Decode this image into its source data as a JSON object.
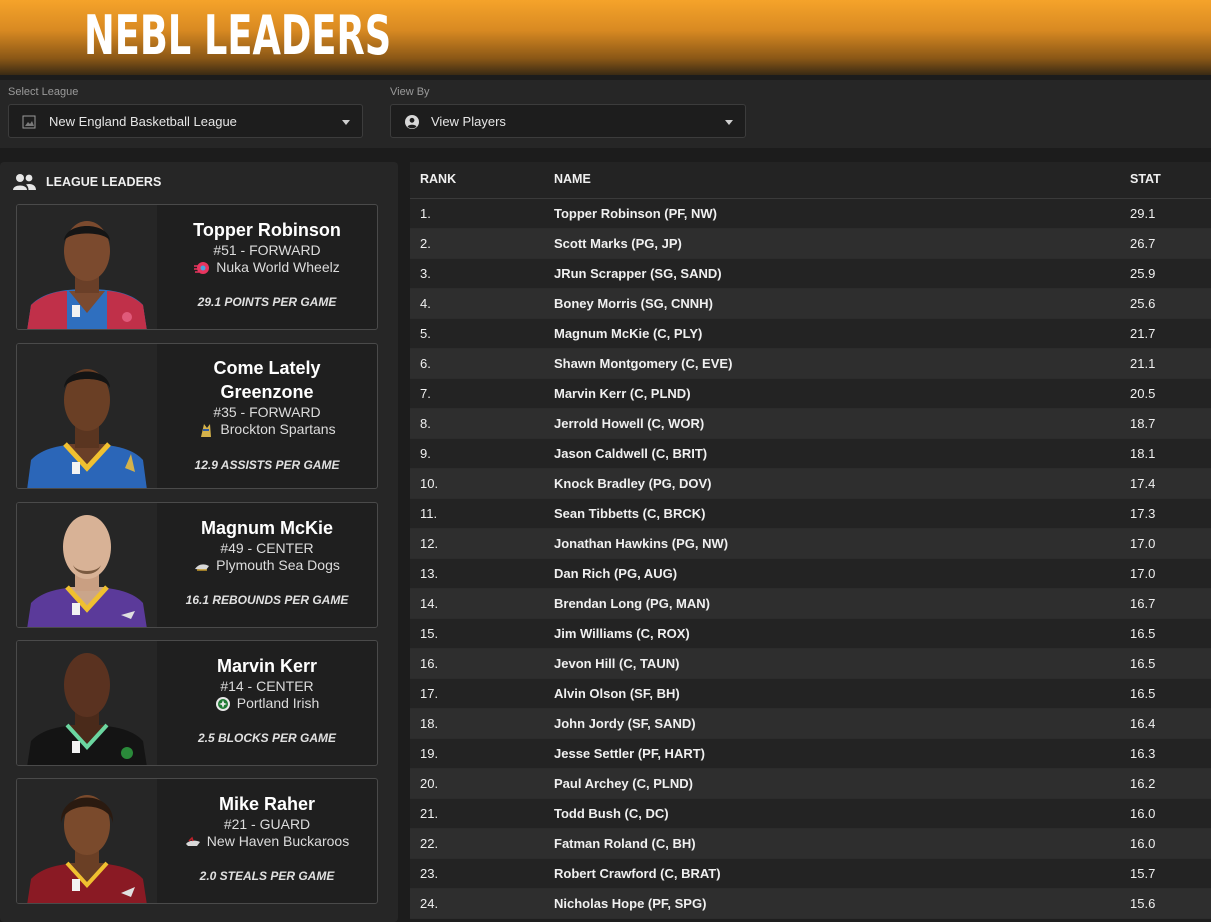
{
  "header": {
    "title": "NEBL LEADERS"
  },
  "filters": {
    "league_label": "Select League",
    "league_value": "New England Basketball League",
    "view_label": "View By",
    "view_value": "View Players"
  },
  "leaders_panel": {
    "title": "LEAGUE LEADERS",
    "cards": [
      {
        "name": "Topper Robinson",
        "number_position": "#51 - FORWARD",
        "team": "Nuka World Wheelz",
        "stat": "29.1 POINTS PER GAME"
      },
      {
        "name": "Come Lately Greenzone",
        "number_position": "#35 - FORWARD",
        "team": "Brockton Spartans",
        "stat": "12.9 ASSISTS PER GAME"
      },
      {
        "name": "Magnum McKie",
        "number_position": "#49 - CENTER",
        "team": "Plymouth Sea Dogs",
        "stat": "16.1 REBOUNDS PER GAME"
      },
      {
        "name": "Marvin Kerr",
        "number_position": "#14 - CENTER",
        "team": "Portland Irish",
        "stat": "2.5 BLOCKS PER GAME"
      },
      {
        "name": "Mike Raher",
        "number_position": "#21 - GUARD",
        "team": "New Haven Buckaroos",
        "stat": "2.0 STEALS PER GAME"
      }
    ]
  },
  "table": {
    "columns": {
      "rank": "RANK",
      "name": "NAME",
      "stat": "STAT"
    },
    "rows": [
      {
        "rank": "1.",
        "name": "Topper Robinson (PF, NW)",
        "stat": "29.1"
      },
      {
        "rank": "2.",
        "name": "Scott Marks (PG, JP)",
        "stat": "26.7"
      },
      {
        "rank": "3.",
        "name": "JRun Scrapper (SG, SAND)",
        "stat": "25.9"
      },
      {
        "rank": "4.",
        "name": "Boney Morris (SG, CNNH)",
        "stat": "25.6"
      },
      {
        "rank": "5.",
        "name": "Magnum McKie (C, PLY)",
        "stat": "21.7"
      },
      {
        "rank": "6.",
        "name": "Shawn Montgomery (C, EVE)",
        "stat": "21.1"
      },
      {
        "rank": "7.",
        "name": "Marvin Kerr (C, PLND)",
        "stat": "20.5"
      },
      {
        "rank": "8.",
        "name": "Jerrold Howell (C, WOR)",
        "stat": "18.7"
      },
      {
        "rank": "9.",
        "name": "Jason Caldwell (C, BRIT)",
        "stat": "18.1"
      },
      {
        "rank": "10.",
        "name": "Knock Bradley (PG, DOV)",
        "stat": "17.4"
      },
      {
        "rank": "11.",
        "name": "Sean Tibbetts (C, BRCK)",
        "stat": "17.3"
      },
      {
        "rank": "12.",
        "name": "Jonathan Hawkins (PG, NW)",
        "stat": "17.0"
      },
      {
        "rank": "13.",
        "name": "Dan Rich (PG, AUG)",
        "stat": "17.0"
      },
      {
        "rank": "14.",
        "name": "Brendan Long (PG, MAN)",
        "stat": "16.7"
      },
      {
        "rank": "15.",
        "name": "Jim Williams (C, ROX)",
        "stat": "16.5"
      },
      {
        "rank": "16.",
        "name": "Jevon Hill (C, TAUN)",
        "stat": "16.5"
      },
      {
        "rank": "17.",
        "name": "Alvin Olson (SF, BH)",
        "stat": "16.5"
      },
      {
        "rank": "18.",
        "name": "John Jordy (SF, SAND)",
        "stat": "16.4"
      },
      {
        "rank": "19.",
        "name": "Jesse Settler (PF, HART)",
        "stat": "16.3"
      },
      {
        "rank": "20.",
        "name": "Paul Archey (C, PLND)",
        "stat": "16.2"
      },
      {
        "rank": "21.",
        "name": "Todd Bush (C, DC)",
        "stat": "16.0"
      },
      {
        "rank": "22.",
        "name": "Fatman Roland (C, BH)",
        "stat": "16.0"
      },
      {
        "rank": "23.",
        "name": "Robert Crawford (C, BRAT)",
        "stat": "15.7"
      },
      {
        "rank": "24.",
        "name": "Nicholas Hope (PF, SPG)",
        "stat": "15.6"
      }
    ]
  },
  "icons": {
    "people": "people-icon",
    "user_circle": "user-circle-icon",
    "league_logo": "league-logo-icon"
  },
  "colors": {
    "header_orange": "#f5a32a",
    "panel_bg": "#262626",
    "row_alt": "#2e2e2e"
  }
}
